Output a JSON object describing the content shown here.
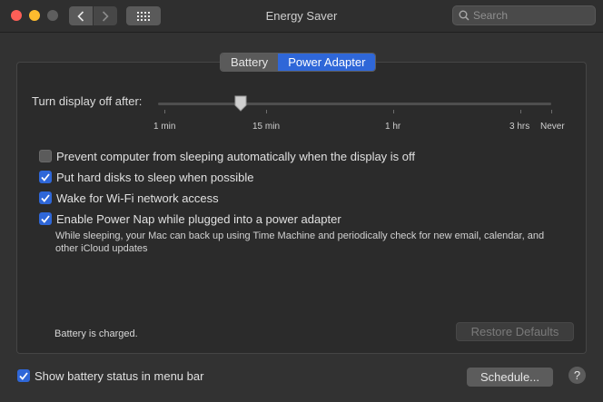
{
  "window": {
    "title": "Energy Saver"
  },
  "toolbar": {
    "search_placeholder": "Search"
  },
  "tabs": [
    {
      "label": "Battery",
      "active": false
    },
    {
      "label": "Power Adapter",
      "active": true
    }
  ],
  "slider": {
    "label": "Turn display off after:",
    "ticks": [
      "1 min",
      "15 min",
      "1 hr",
      "3 hrs",
      "Never"
    ],
    "value": "15 min"
  },
  "options": [
    {
      "label": "Prevent computer from sleeping automatically when the display is off",
      "checked": false
    },
    {
      "label": "Put hard disks to sleep when possible",
      "checked": true
    },
    {
      "label": "Wake for Wi-Fi network access",
      "checked": true
    },
    {
      "label": "Enable Power Nap while plugged into a power adapter",
      "checked": true
    }
  ],
  "power_nap_description": "While sleeping, your Mac can back up using Time Machine and periodically check for new email, calendar, and other iCloud updates",
  "status_text": "Battery is charged.",
  "restore_label": "Restore Defaults",
  "footer": {
    "show_battery_label": "Show battery status in menu bar",
    "show_battery_checked": true,
    "schedule_label": "Schedule...",
    "help_label": "?"
  },
  "colors": {
    "accent": "#2f67d8",
    "window_bg": "#323232"
  }
}
